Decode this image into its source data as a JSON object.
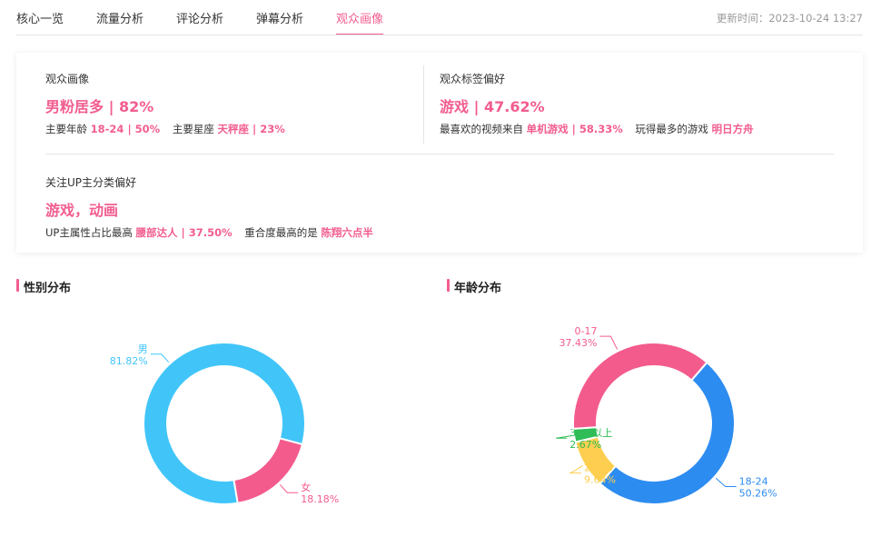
{
  "tabs": [
    {
      "label": "核心一览",
      "active": false
    },
    {
      "label": "流量分析",
      "active": false
    },
    {
      "label": "评论分析",
      "active": false
    },
    {
      "label": "弹幕分析",
      "active": false
    },
    {
      "label": "观众画像",
      "active": true
    }
  ],
  "update_time": "更新时间：2023-10-24 13:27",
  "summary": {
    "portrait": {
      "label": "观众画像",
      "headline": "男粉居多 | 82%",
      "age_label": "主要年龄",
      "age_value": "18-24 | 50%",
      "star_label": "主要星座",
      "star_value": "天秤座 | 23%"
    },
    "tags": {
      "label": "观众标签偏好",
      "headline": "游戏 | 47.62%",
      "video_label": "最喜欢的视频来自",
      "video_value": "单机游戏 | 58.33%",
      "game_label": "玩得最多的游戏",
      "game_value": "明日方舟"
    },
    "up": {
      "label": "关注UP主分类偏好",
      "headline": "游戏，动画",
      "attr_label": "UP主属性占比最高",
      "attr_value": "腰部达人 | 37.50%",
      "overlap_label": "重合度最高的是",
      "overlap_value": "陈翔六点半"
    }
  },
  "sections": {
    "gender_title": "性别分布",
    "age_title": "年龄分布"
  },
  "chart_data": [
    {
      "type": "pie",
      "title": "性别分布",
      "slices": [
        {
          "name": "男",
          "value": 81.82,
          "label": "81.82%",
          "color": "#41c5f9"
        },
        {
          "name": "女",
          "value": 18.18,
          "label": "18.18%",
          "color": "#f35b8d"
        }
      ]
    },
    {
      "type": "pie",
      "title": "年龄分布",
      "slices": [
        {
          "name": "18-24",
          "value": 50.26,
          "label": "50.26%",
          "color": "#2d8cf0"
        },
        {
          "name": "25-30",
          "value": 9.64,
          "label": "9.64%",
          "color": "#fdce4f"
        },
        {
          "name": "30岁以上",
          "value": 2.67,
          "label": "2.67%",
          "color": "#2ebd56"
        },
        {
          "name": "0-17",
          "value": 37.43,
          "label": "37.43%",
          "color": "#f35b8d"
        }
      ]
    }
  ]
}
